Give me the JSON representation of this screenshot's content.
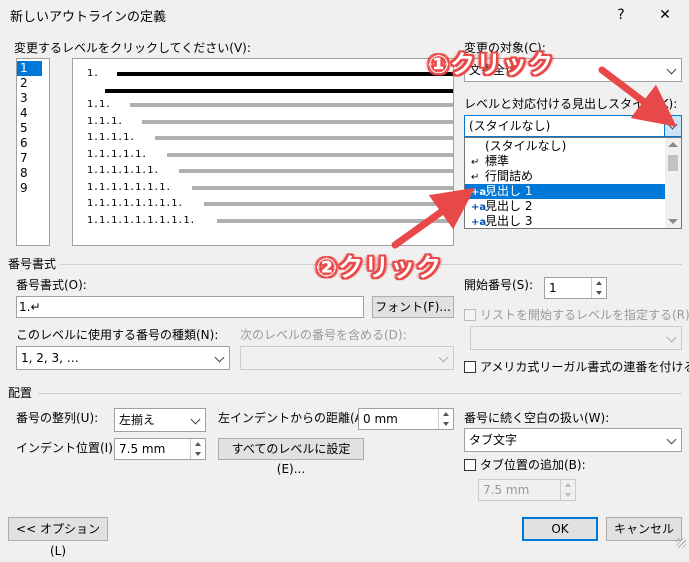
{
  "window": {
    "title": "新しいアウトラインの定義",
    "help": "?",
    "close": "✕"
  },
  "levels": {
    "label": "変更するレベルをクリックしてください(V):",
    "items": [
      "1",
      "2",
      "3",
      "4",
      "5",
      "6",
      "7",
      "8",
      "9"
    ],
    "selected": "1"
  },
  "preview": {
    "rows": [
      "1.",
      "1.1.",
      "1.1.1.",
      "1.1.1.1.",
      "1.1.1.1.1.",
      "1.1.1.1.1.1.",
      "1.1.1.1.1.1.1.",
      "1.1.1.1.1.1.1.1.",
      "1.1.1.1.1.1.1.1.1."
    ]
  },
  "apply_to": {
    "label": "変更の対象(C):",
    "value": "文書全体"
  },
  "link_style": {
    "label": "レベルと対応付ける見出しスタイル(K):",
    "value": "(スタイルなし)",
    "options": [
      {
        "icon": "",
        "label": "(スタイルなし)"
      },
      {
        "icon": "↵",
        "label": "標準"
      },
      {
        "icon": "↵",
        "label": "行間詰め"
      },
      {
        "icon": "+a",
        "label": "見出し 1"
      },
      {
        "icon": "+a",
        "label": "見出し 2"
      },
      {
        "icon": "+a",
        "label": "見出し 3"
      }
    ],
    "selected_index": 3
  },
  "number_format": {
    "section": "番号書式",
    "format_label": "番号書式(O):",
    "format_value": "1.↵",
    "font_button": "フォント(F)...",
    "style_label": "このレベルに使用する番号の種類(N):",
    "style_value": "1, 2, 3, …",
    "include_label": "次のレベルの番号を含める(D):",
    "start_label": "開始番号(S):",
    "start_value": "1",
    "restart_label": "リストを開始するレベルを指定する(R):",
    "legal_label": "アメリカ式リーガル書式の連番を付ける(G)"
  },
  "position": {
    "section": "配置",
    "alignment_label": "番号の整列(U):",
    "alignment_value": "左揃え",
    "indent_label": "左インデントからの距離(A):",
    "indent_value": "0 mm",
    "text_indent_label": "インデント位置(I):",
    "text_indent_value": "7.5 mm",
    "set_all_button": "すべてのレベルに設定(E)...",
    "follow_label": "番号に続く空白の扱い(W):",
    "follow_value": "タブ文字",
    "tab_add_label": "タブ位置の追加(B):",
    "tab_value": "7.5 mm"
  },
  "footer": {
    "options_button": "<< オプション(L)",
    "ok": "OK",
    "cancel": "キャンセル"
  },
  "annotations": {
    "first": "①クリック",
    "second": "②クリック"
  },
  "colors": {
    "accent": "#0078d7",
    "callout": "#e84848"
  }
}
